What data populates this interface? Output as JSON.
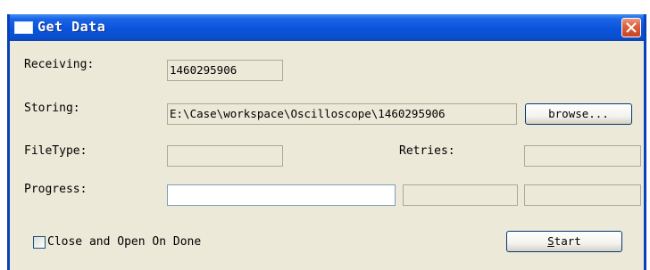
{
  "window": {
    "title": "Get Data"
  },
  "fields": {
    "receiving_label": "Receiving:",
    "receiving_value": "1460295906",
    "storing_label": "Storing:",
    "storing_value": "E:\\Case\\workspace\\Oscilloscope\\1460295906",
    "browse_label": "browse...",
    "filetype_label": "FileType:",
    "filetype_value": "",
    "retries_label": "Retries:",
    "retries_value": "",
    "progress_label": "Progress:",
    "progress_value": 0,
    "progress_info_1": "",
    "progress_info_2": ""
  },
  "footer": {
    "checkbox_label": "Close and Open On Done",
    "checkbox_checked": false,
    "start_prefix": "S",
    "start_rest": "tart"
  },
  "colors": {
    "titlebar": "#0a54da",
    "close_button": "#e0613c",
    "dialog_background": "#ece9d8"
  }
}
